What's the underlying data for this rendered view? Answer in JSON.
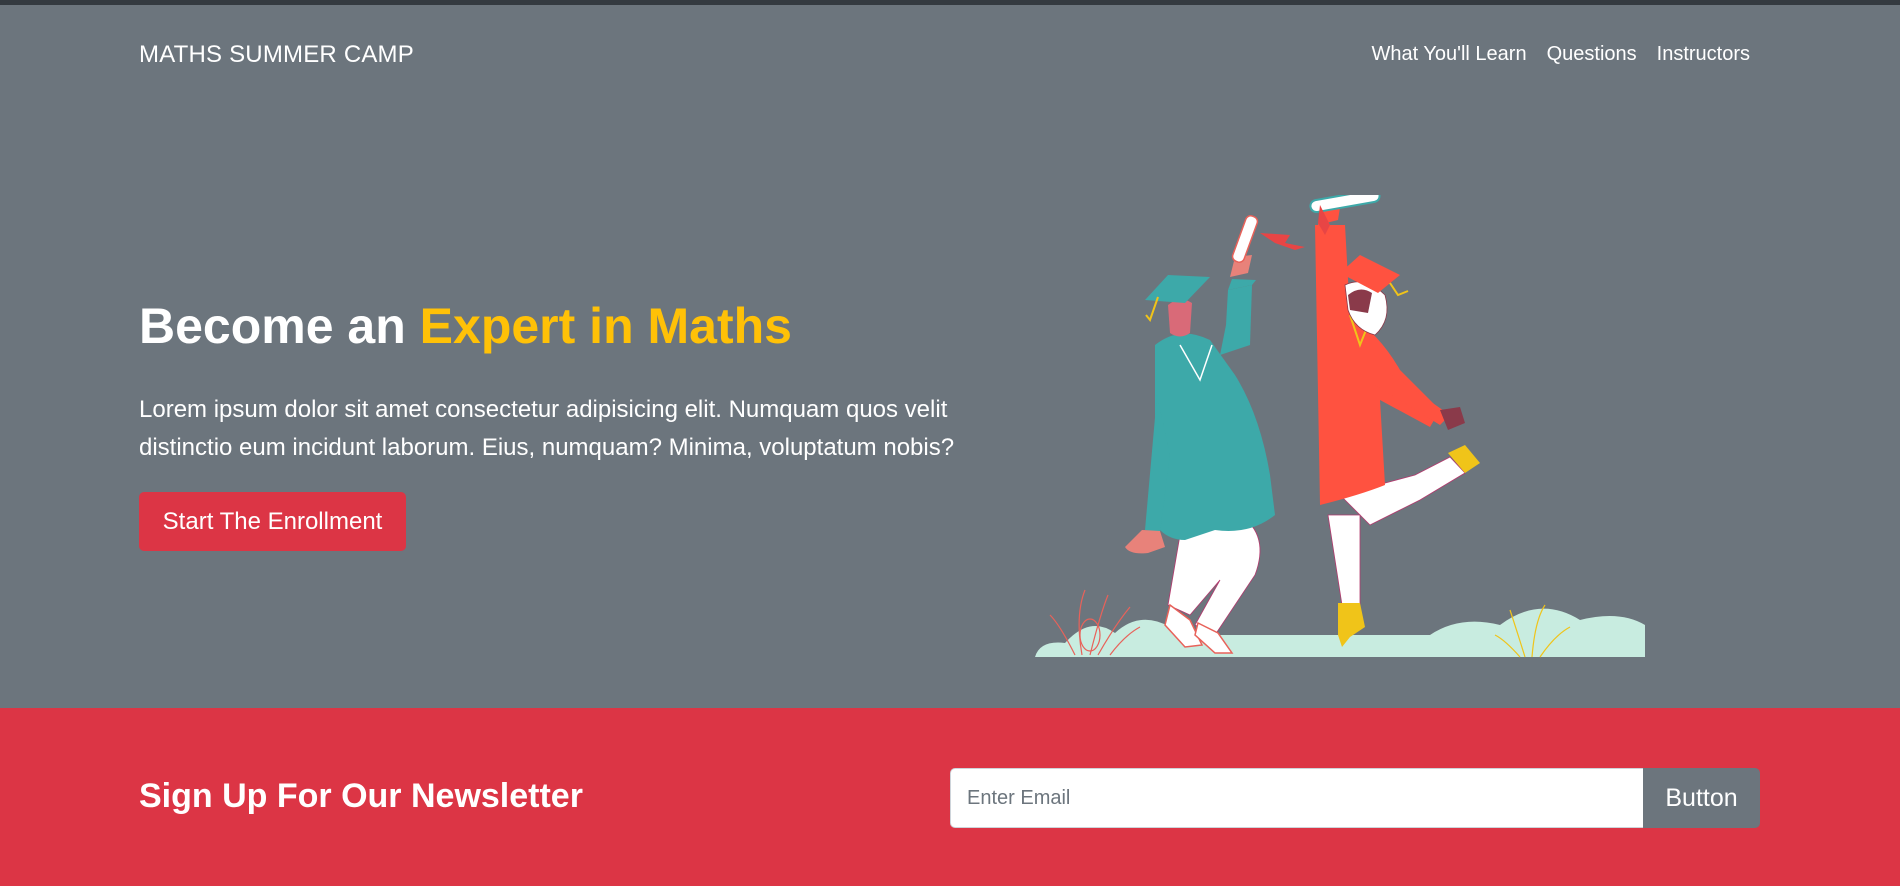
{
  "navbar": {
    "brand": "MATHS SUMMER CAMP",
    "links": [
      "What You'll Learn",
      "Questions",
      "Instructors"
    ]
  },
  "hero": {
    "title_prefix": "Become an ",
    "title_accent": "Expert in Maths",
    "lead_line1": "Lorem ipsum dolor sit amet consectetur adipisicing elit. Numquam quos velit",
    "lead_line2": "distinctio eum incidunt laborum. Eius, numquam? Minima, voluptatum nobis?",
    "cta_label": "Start The Enrollment",
    "illustration": "graduation-illustration"
  },
  "newsletter": {
    "title": "Sign Up For Our Newsletter",
    "email_placeholder": "Enter Email",
    "email_value": "",
    "button_label": "Button"
  },
  "colors": {
    "hero_bg": "#6c757d",
    "accent": "#ffc107",
    "primary_red": "#dc3545",
    "top_bar": "#343a40"
  }
}
